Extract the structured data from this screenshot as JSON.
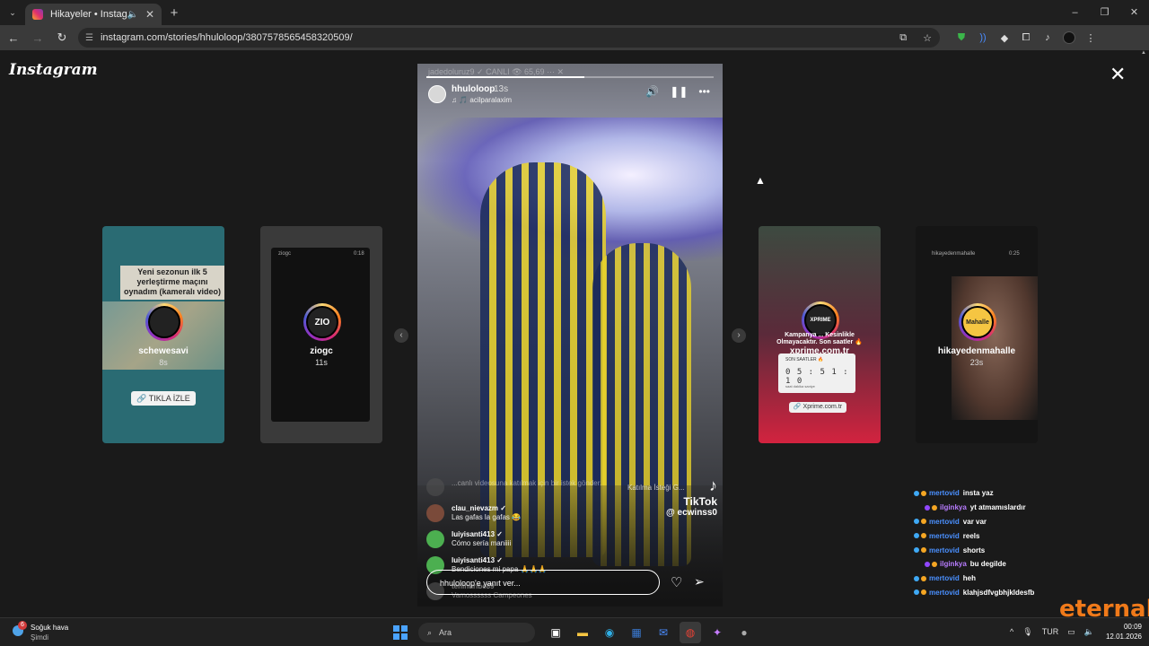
{
  "browser": {
    "tab_title": "Hikayeler • Instagram",
    "url": "instagram.com/stories/hhuloloop/3807578565458320509/",
    "new_tab": "+",
    "win_min": "–",
    "win_max": "❐",
    "win_close": "✕"
  },
  "page": {
    "logo": "Instagram",
    "close": "✕"
  },
  "side_stories": [
    {
      "username": "schewesavi",
      "age": "8s",
      "banner": "Yeni sezonun ilk 5 yerleştirme maçını oynadım (kameralı video)",
      "cta": "🔗 TIKLA İZLE"
    },
    {
      "username": "ziogc",
      "age": "11s",
      "avatar_text": "ZIO",
      "mini_name": "ziogc",
      "mini_time": "0:18"
    },
    {
      "username": "xprime.com.tr",
      "promo": "Kampanya ... Kesinlikle Olmayacaktır. Son saatler 🔥",
      "timer_label": "SON SAATLER 🔥",
      "timer_digits": "0 5 : 5 1 : 1 0",
      "timer_units": "saat    dakika    saniye",
      "link": "🔗 Xprime.com.tr",
      "avatar_text": "XPRIME"
    },
    {
      "username": "hikayedenmahalle",
      "age": "23s",
      "avatar_text": "Mahalle",
      "mini_name": "hikayedenmahalle",
      "mini_time": "0:25"
    }
  ],
  "story": {
    "ghost_header": "jadedoluruz9  ✓      CANLI      👁 65,69      ···  ✕",
    "username": "hhuloloop",
    "time": "13s",
    "music": "♫ 🎵 acilparalaxim",
    "progress": 0.55,
    "tiktok_label": "TikTok",
    "tiktok_user": "@ ecwinss0",
    "join_text": "Katılma İsteği G...",
    "comments": [
      {
        "name": "",
        "text": "...canlı videosuna katılmak için bir istek gönder.",
        "faded": true,
        "color": "#555"
      },
      {
        "name": "clau_nievazm ✓",
        "text": "Las gafas la gafas 😂",
        "faded": false,
        "color": "#7a4a3a"
      },
      {
        "name": "luiyisanti413 ✓",
        "text": "Cómo sería maniiii",
        "faded": false,
        "color": "#4caf50"
      },
      {
        "name": "luiyisanti413 ✓",
        "text": "Bendiciones mi papa 🙏🙏🙏",
        "faded": false,
        "color": "#4caf50"
      },
      {
        "name": "teninuribe89",
        "text": "Vamossssss Campeones",
        "faded": true,
        "color": "#777"
      }
    ],
    "reply_placeholder": "hhuloloop'e yanıt ver..."
  },
  "chat": [
    {
      "user": "mertovid",
      "msg": "insta yaz",
      "indent": false,
      "purple": false
    },
    {
      "user": "ilginkya",
      "msg": "yt atmamıslardır",
      "indent": true,
      "purple": true
    },
    {
      "user": "mertovid",
      "msg": "var var",
      "indent": false,
      "purple": false
    },
    {
      "user": "mertovid",
      "msg": "reels",
      "indent": false,
      "purple": false
    },
    {
      "user": "mertovid",
      "msg": "shorts",
      "indent": false,
      "purple": false
    },
    {
      "user": "ilginkya",
      "msg": "bu degilde",
      "indent": true,
      "purple": true
    },
    {
      "user": "mertovid",
      "msg": "heh",
      "indent": false,
      "purple": false
    },
    {
      "user": "mertovid",
      "msg": "klahjsdfvgbhjkldesfb",
      "indent": false,
      "purple": false
    }
  ],
  "watermark": "eternal",
  "taskbar": {
    "weather_title": "Soğuk hava",
    "weather_sub": "Şimdi",
    "weather_badge": "6",
    "search_placeholder": "Ara",
    "lang": "TUR",
    "time": "00:09",
    "date": "12.01.2026"
  }
}
